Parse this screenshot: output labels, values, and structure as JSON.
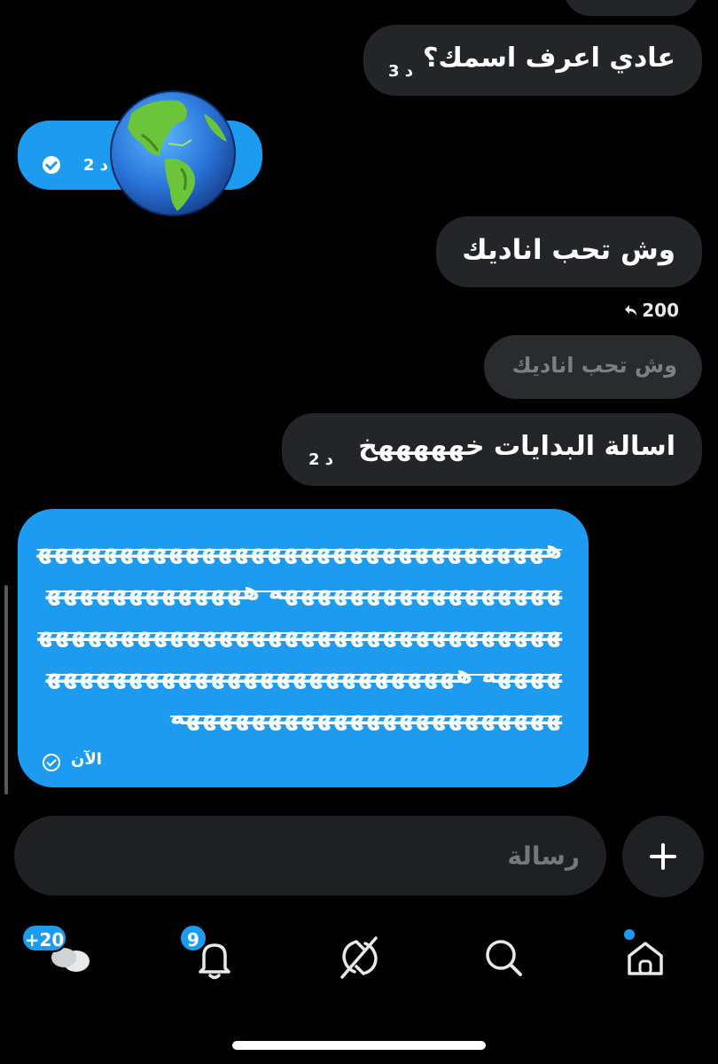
{
  "messages": {
    "m1": {
      "text": "عادي اعرف اسمك؟",
      "time": "3 د"
    },
    "m2": {
      "time": "2 د"
    },
    "m3": {
      "text": "وش تحب اناديك"
    },
    "reply": {
      "count": "200"
    },
    "m4": {
      "quote": "وش تحب اناديك",
      "text": "اسالة البدايات خهههههخ",
      "time": "2 د"
    },
    "m5": {
      "text": "هههههههههههههههههههههههههههههههههههههههههههههههههه هههههههههههههههههههههههههههههههههههههههههههههههههه هههههههههههههههههههههههههههههههههههههههههههههههههه",
      "time": "الآن"
    }
  },
  "composer": {
    "placeholder": "رسالة"
  },
  "nav": {
    "messages_badge": "+20",
    "notifications_badge": "9"
  },
  "colors": {
    "accent": "#1d9bf0",
    "bubble_received": "#242528",
    "background": "#000000"
  },
  "icons": [
    "globe-emoji",
    "check-icon",
    "reply-arrow-icon",
    "plus-icon",
    "messages-icon",
    "bell-icon",
    "grok-icon",
    "search-icon",
    "home-icon"
  ]
}
